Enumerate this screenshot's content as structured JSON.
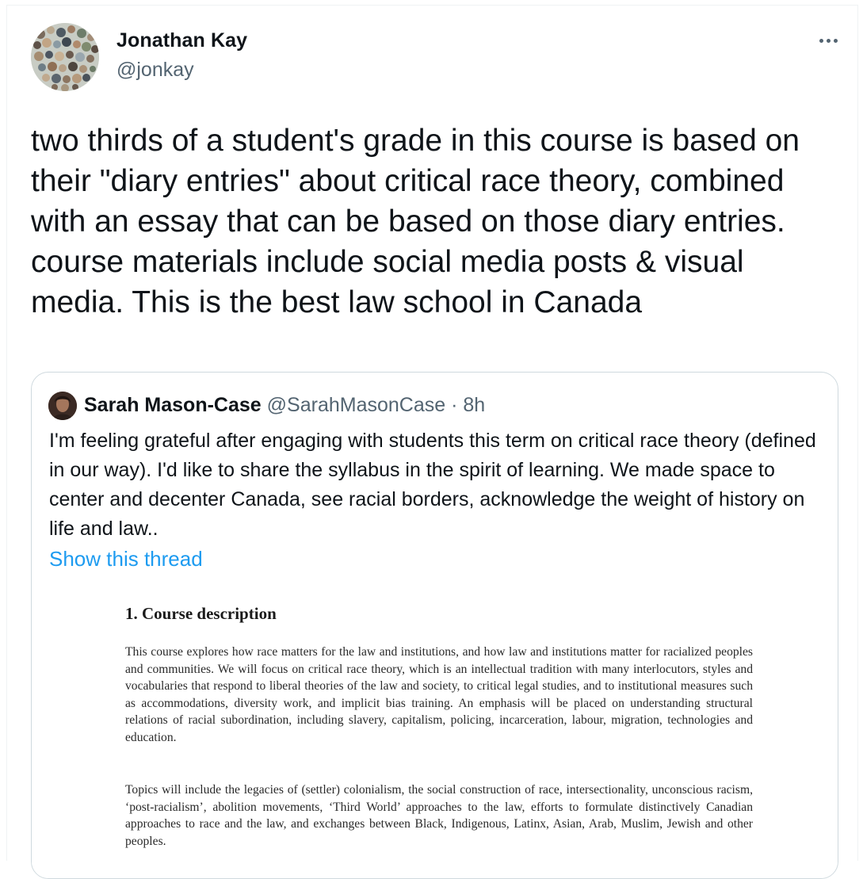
{
  "tweet": {
    "author": {
      "name": "Jonathan Kay",
      "handle": "@jonkay",
      "avatar_icon": "mosaic-collage-avatar"
    },
    "more_icon": "more-horizontal-icon",
    "text": "two thirds of a student's grade in this course is based on their \"diary entries\" about critical race theory, combined with an essay that can be based on those diary entries. course materials include social media posts & visual media. This is the best law school in Canada"
  },
  "quote": {
    "author": {
      "name": "Sarah Mason-Case",
      "handle": "@SarahMasonCase",
      "separator": "·",
      "time": "8h",
      "avatar_icon": "profile-photo-avatar"
    },
    "text": "I'm feeling grateful after engaging with students this term on critical race theory (defined in our way). I'd like to share the syllabus in the spirit of learning. We made space to center and decenter Canada, see racial borders, acknowledge the weight of history on life and law..",
    "show_thread_label": "Show this thread",
    "document": {
      "heading": "1.  Course description",
      "paragraphs": [
        "This course explores how race matters for the law and institutions, and how law and institutions matter for racialized peoples and communities. We will focus on critical race theory, which is an intellectual tradition with many interlocutors, styles and vocabularies that respond to liberal theories of the law and society, to critical legal studies, and to institutional measures such as accommodations, diversity work, and implicit bias training. An emphasis will be placed on understanding structural relations of racial subordination, including slavery, capitalism, policing, incarceration, labour, migration, technologies and education.",
        "Topics will include the legacies of (settler) colonialism, the social construction of race, intersectionality, unconscious racism, ‘post-racialism’, abolition movements, ‘Third World’ approaches to the law, efforts to formulate distinctively Canadian approaches to race and the law, and exchanges between Black, Indigenous, Latinx, Asian, Arab, Muslim, Jewish and other peoples."
      ]
    }
  },
  "colors": {
    "primary_text": "#0f1419",
    "secondary_text": "#536471",
    "link": "#1d9bf0",
    "border": "#cfd9de"
  }
}
